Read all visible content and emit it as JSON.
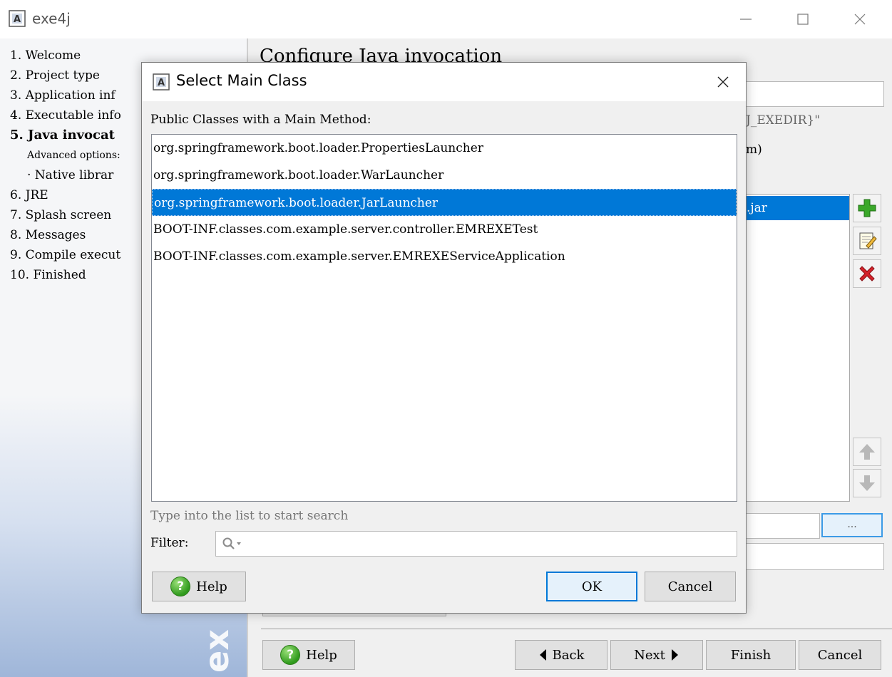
{
  "window": {
    "title": "exe4j"
  },
  "steps": [
    {
      "label": "1. Welcome",
      "style": "normal"
    },
    {
      "label": "2. Project type",
      "style": "normal"
    },
    {
      "label": "3. Application inf",
      "style": "normal"
    },
    {
      "label": "4. Executable info",
      "style": "normal"
    },
    {
      "label": "5. Java invocat",
      "style": "active"
    },
    {
      "label": "Advanced options:",
      "style": "sub-head"
    },
    {
      "label": "· Native librar",
      "style": "sub"
    },
    {
      "label": "6. JRE",
      "style": "normal"
    },
    {
      "label": "7. Splash screen",
      "style": "normal"
    },
    {
      "label": "8. Messages",
      "style": "normal"
    },
    {
      "label": "9. Compile execut",
      "style": "normal"
    },
    {
      "label": "10. Finished",
      "style": "normal"
    }
  ],
  "content": {
    "title": "Configure Java invocation",
    "partial_text_1": "J_EXEDIR}\"",
    "partial_text_2": "m)",
    "partial_list_item": ".jar",
    "browse_label": "...",
    "buttons": {
      "help": "Help",
      "back": "Back",
      "next": "Next",
      "finish": "Finish",
      "cancel": "Cancel"
    }
  },
  "dialog": {
    "title": "Select Main Class",
    "classes_label": "Public Classes with a Main Method:",
    "classes": [
      "org.springframework.boot.loader.PropertiesLauncher",
      "org.springframework.boot.loader.WarLauncher",
      "org.springframework.boot.loader.JarLauncher",
      "BOOT-INF.classes.com.example.server.controller.EMREXETest",
      "BOOT-INF.classes.com.example.server.EMREXEServiceApplication"
    ],
    "selected_index": 2,
    "search_hint": "Type into the list to start search",
    "filter_label": "Filter:",
    "filter_value": "",
    "buttons": {
      "help": "Help",
      "ok": "OK",
      "cancel": "Cancel"
    }
  },
  "icons": {
    "app": "exe4j-app-icon",
    "add": "add-icon",
    "edit": "edit-icon",
    "delete": "delete-icon",
    "move_up": "arrow-up-icon",
    "move_down": "arrow-down-icon",
    "help": "help-icon",
    "search": "search-icon"
  },
  "colors": {
    "selection": "#0078d7",
    "add_green": "#3aa829",
    "delete_red": "#d4232b"
  }
}
